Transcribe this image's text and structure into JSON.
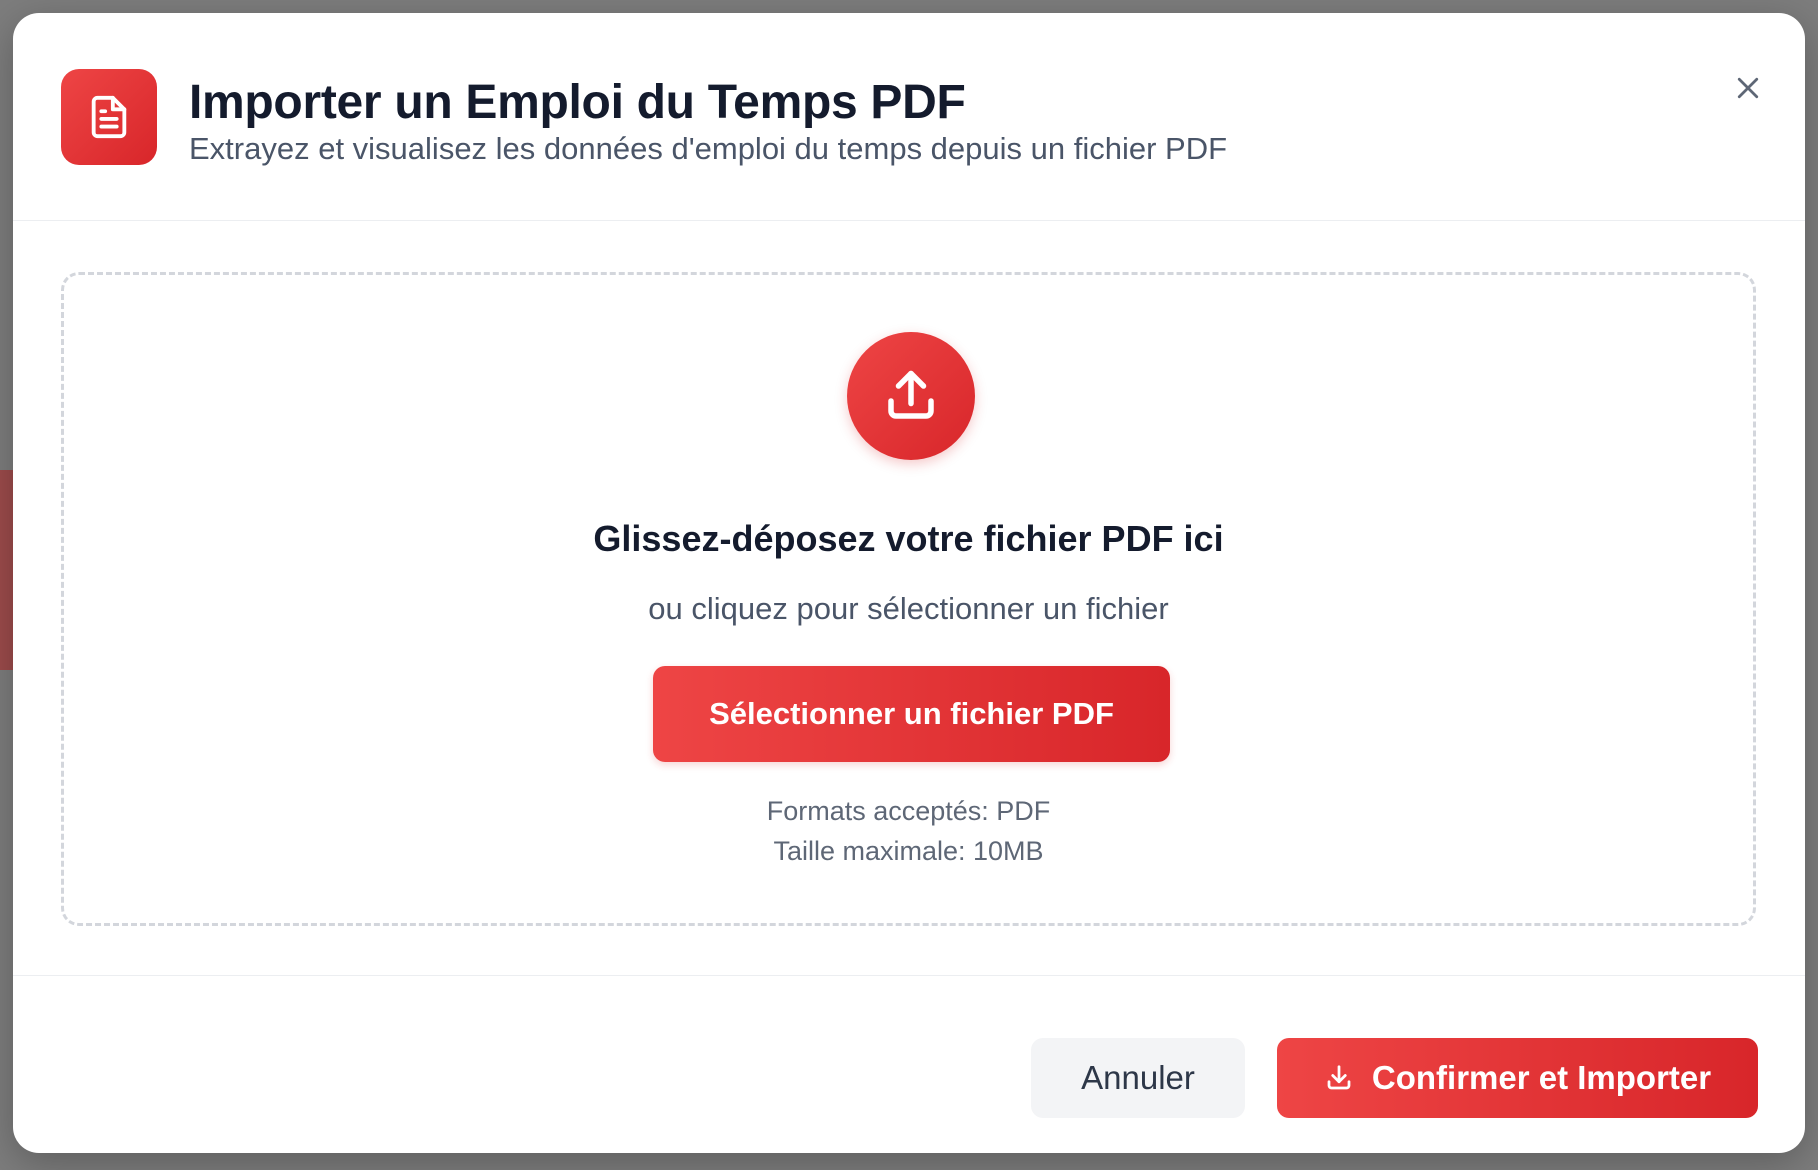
{
  "header": {
    "icon": "file-text-icon",
    "title": "Importer un Emploi du Temps PDF",
    "subtitle": "Extrayez et visualisez les données d'emploi du temps depuis un fichier PDF",
    "close_icon": "close-icon"
  },
  "dropzone": {
    "icon": "upload-icon",
    "title": "Glissez-déposez votre fichier PDF ici",
    "subtitle": "ou cliquez pour sélectionner un fichier",
    "select_button_label": "Sélectionner un fichier PDF",
    "formats_text": "Formats acceptés: PDF",
    "max_size_text": "Taille maximale: 10MB"
  },
  "footer": {
    "cancel_label": "Annuler",
    "confirm_label": "Confirmer et Importer",
    "confirm_icon": "download-icon"
  },
  "colors": {
    "accent": "#e53535",
    "accent_dark": "#d8262a",
    "title": "#141b2d",
    "muted": "#4a5568"
  }
}
